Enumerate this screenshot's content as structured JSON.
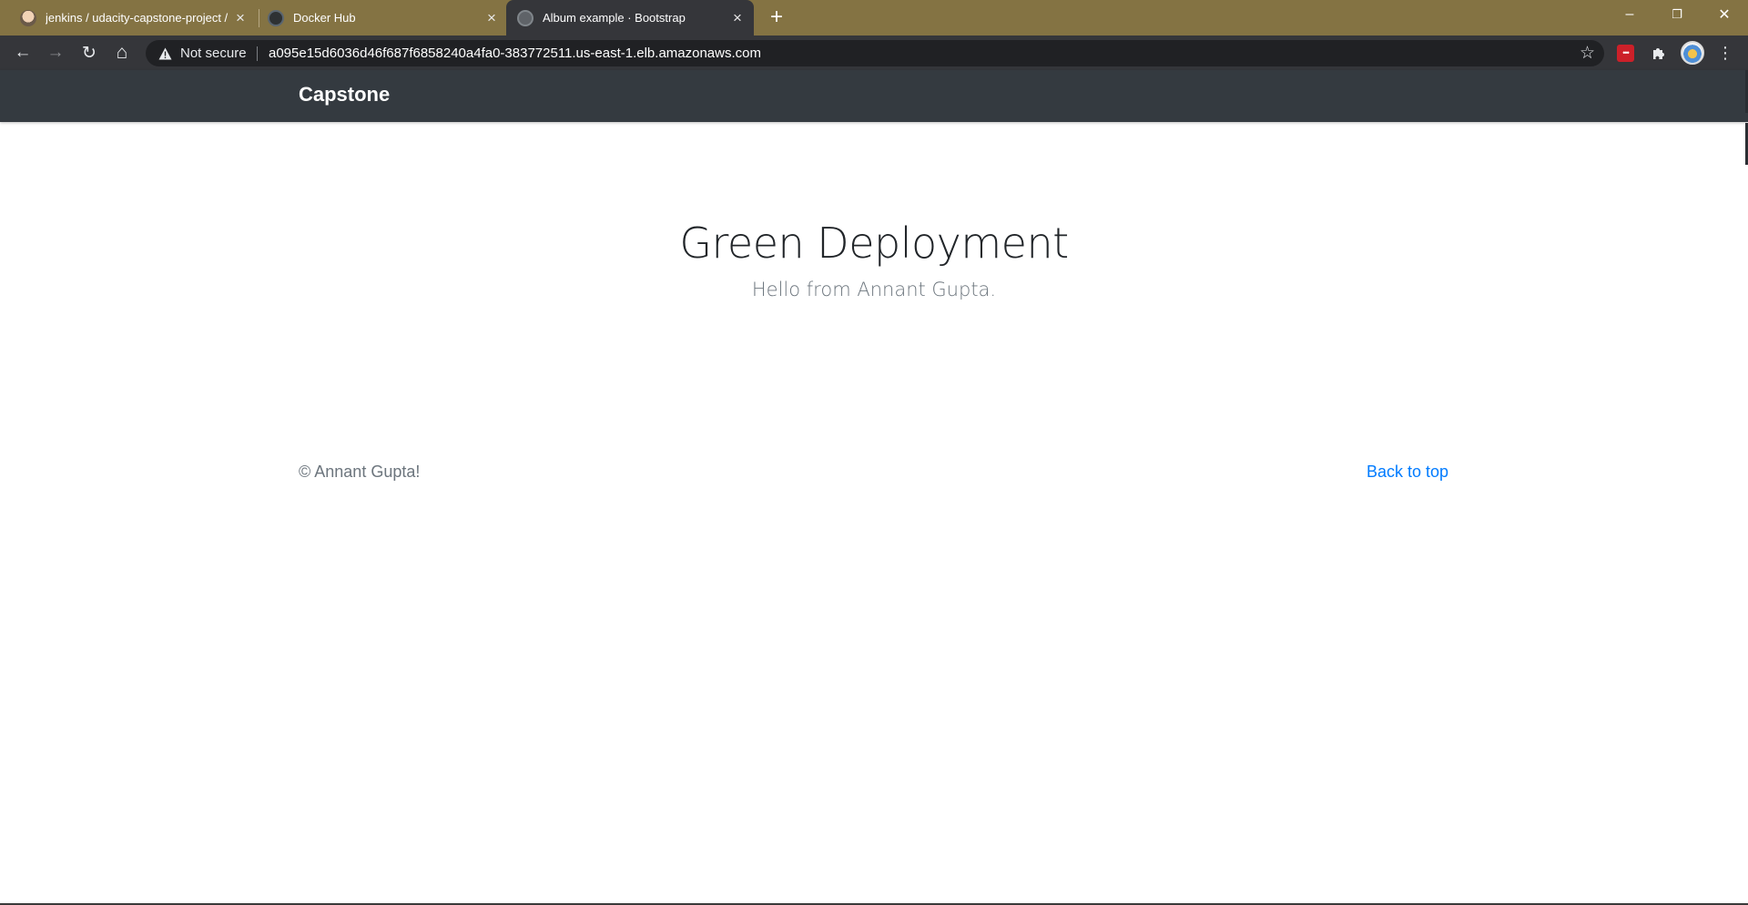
{
  "browser": {
    "tabs": [
      {
        "title": "jenkins / udacity-capstone-project /",
        "favicon": "jenkins-icon"
      },
      {
        "title": "Docker Hub",
        "favicon": "docker-icon"
      },
      {
        "title": "Album example · Bootstrap",
        "favicon": "globe-icon",
        "active": true
      }
    ],
    "new_tab_symbol": "+",
    "window": {
      "minimize": "–",
      "restore": "❐",
      "close": "✕"
    },
    "toolbar": {
      "back_symbol": "←",
      "forward_symbol": "→",
      "reload_symbol": "↻",
      "home_symbol": "⌂",
      "security_icon": "!",
      "security_label": "Not secure",
      "url": "a095e15d6036d46f687f6858240a4fa0-383772511.us-east-1.elb.amazonaws.com",
      "bookmark_symbol": "☆",
      "extensions_symbol": "⧉",
      "lastpass_symbol": "•••",
      "menu_symbol": "⋮"
    },
    "colors": {
      "tabstrip": "#847343",
      "toolbar": "#35363a"
    }
  },
  "page": {
    "brand": "Capstone",
    "hero": {
      "title": "Green Deployment",
      "lead": "Hello from Annant Gupta."
    },
    "footer": {
      "copyright": "© Annant Gupta!",
      "back_to_top": "Back to top"
    },
    "colors": {
      "navbar": "#343a40",
      "link": "#007bff",
      "muted": "#6c757d"
    }
  }
}
